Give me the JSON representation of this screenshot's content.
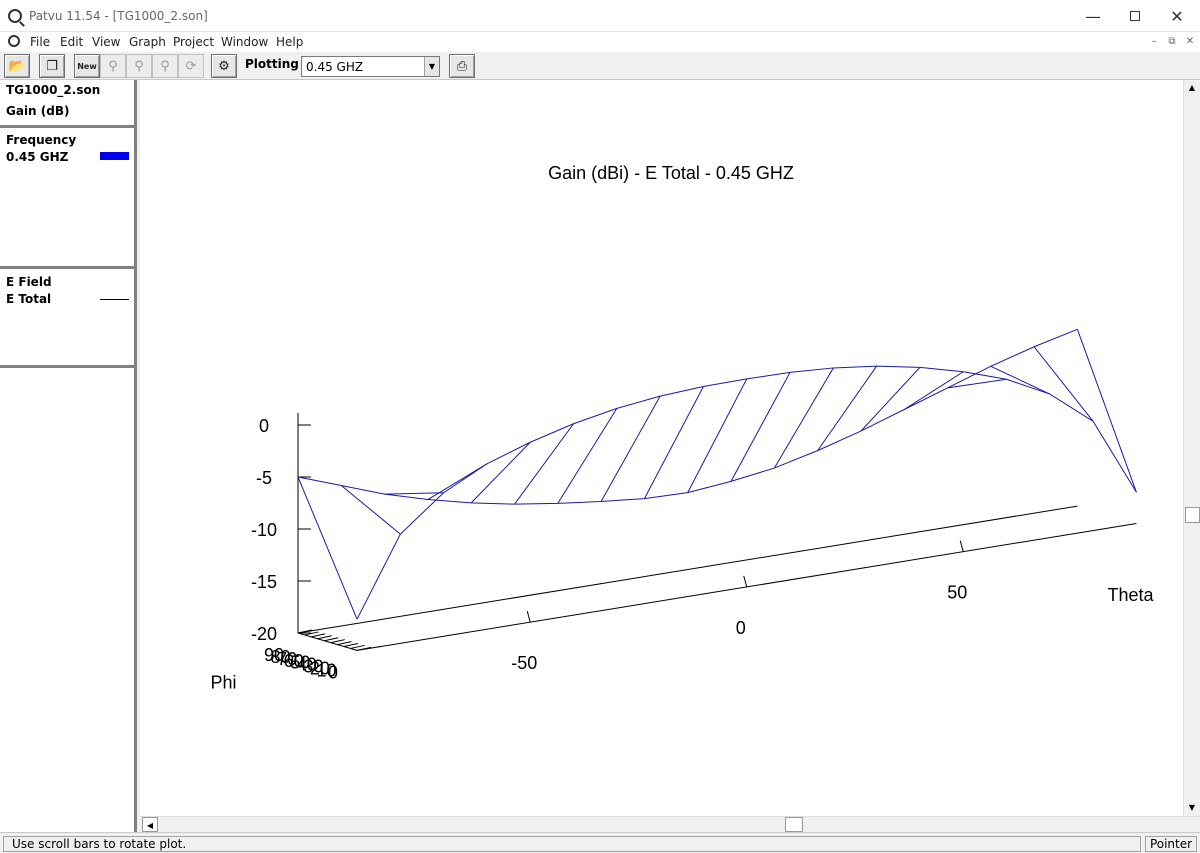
{
  "window": {
    "title": "Patvu 11.54 - [TG1000_2.son]"
  },
  "menu": [
    "File",
    "Edit",
    "View",
    "Graph",
    "Project",
    "Window",
    "Help"
  ],
  "toolbar": {
    "plotting_label": "Plotting",
    "selected_frequency": "0.45 GHZ",
    "new_label": "New"
  },
  "sidebar": {
    "file_name": "TG1000_2.son",
    "quantity": "Gain (dB)",
    "frequency_header": "Frequency",
    "frequency_item": "0.45 GHZ",
    "frequency_color": "#0000ee",
    "field_header": "E Field",
    "field_item": "E Total"
  },
  "status": {
    "message": "Use scroll bars to rotate plot.",
    "mode": "Pointer"
  },
  "chart_data": {
    "type": "surface",
    "title": "Gain (dBi) - E Total - 0.45 GHZ",
    "x_axis": {
      "label": "Theta",
      "range": [
        -90,
        90
      ],
      "ticks": [
        -50,
        0,
        50
      ]
    },
    "y_axis": {
      "label": "Phi",
      "range": [
        0,
        90
      ],
      "ticks": [
        0,
        10,
        20,
        30,
        40,
        50,
        60,
        70,
        80,
        90
      ]
    },
    "z_axis": {
      "label": "",
      "range": [
        -20,
        0
      ],
      "ticks": [
        -20,
        -15,
        -10,
        -5,
        0
      ]
    },
    "line_color": "#1a1aa6",
    "phi": [
      0,
      90
    ],
    "theta": [
      -90,
      -80,
      -70,
      -60,
      -50,
      -40,
      -30,
      -20,
      -10,
      0,
      10,
      20,
      30,
      40,
      50,
      60,
      70,
      80,
      90
    ],
    "series": [
      {
        "name": "Phi = 0",
        "values": [
          -17,
          -9.5,
          -6.2,
          -4.1,
          -2.7,
          -1.6,
          -0.8,
          -0.3,
          -0.05,
          0,
          -0.05,
          -0.3,
          -0.8,
          -1.6,
          -2.7,
          -4.1,
          -6.2,
          -9.5,
          -17
        ]
      },
      {
        "name": "Phi = 90",
        "values": [
          -5,
          -6.5,
          -8,
          -9.2,
          -10.2,
          -11,
          -11.6,
          -12.1,
          -12.5,
          -12.6,
          -12.2,
          -11.6,
          -10.6,
          -9.4,
          -8,
          -6.6,
          -5.2,
          -4,
          -3
        ]
      }
    ]
  }
}
